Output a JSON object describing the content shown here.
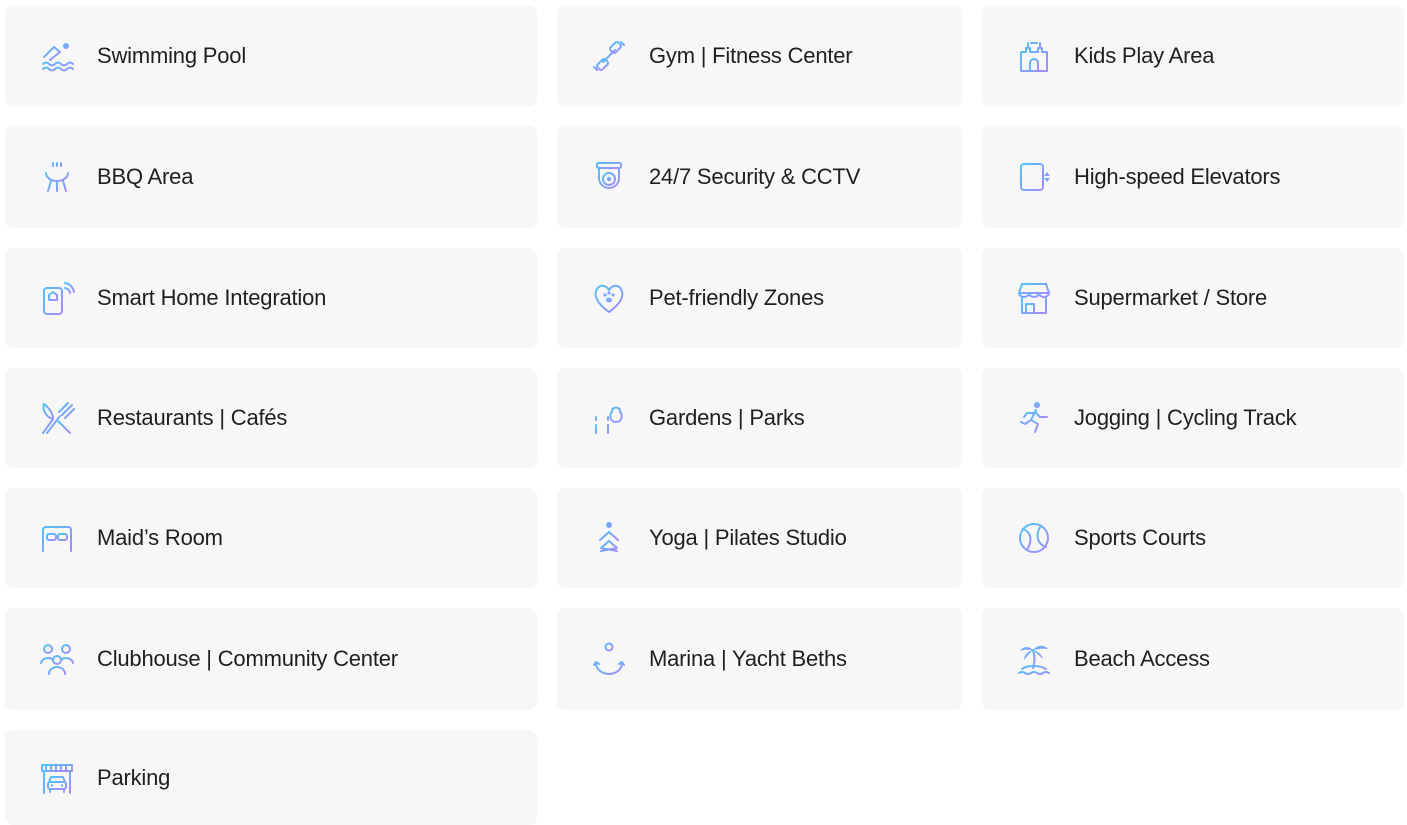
{
  "colors": {
    "card_background": "#f7f7f7",
    "icon_gradient_start": "#4fc3f7",
    "icon_gradient_end": "#a78bfa",
    "text": "#1f1f1f"
  },
  "amenities": [
    {
      "label": "Swimming Pool",
      "icon": "swimming-pool-icon"
    },
    {
      "label": "Gym | Fitness Center",
      "icon": "dumbbell-icon"
    },
    {
      "label": "Kids Play Area",
      "icon": "castle-icon"
    },
    {
      "label": "BBQ Area",
      "icon": "bbq-grill-icon"
    },
    {
      "label": "24/7 Security & CCTV",
      "icon": "cctv-camera-icon"
    },
    {
      "label": "High-speed Elevators",
      "icon": "elevator-icon"
    },
    {
      "label": "Smart Home Integration",
      "icon": "smart-phone-home-icon"
    },
    {
      "label": "Pet-friendly Zones",
      "icon": "heart-paw-icon"
    },
    {
      "label": "Supermarket / Store",
      "icon": "storefront-icon"
    },
    {
      "label": "Restaurants | Cafés",
      "icon": "fork-knife-icon"
    },
    {
      "label": "Gardens | Parks",
      "icon": "park-bench-tree-icon"
    },
    {
      "label": "Jogging | Cycling Track",
      "icon": "running-person-icon"
    },
    {
      "label": "Maid’s Room",
      "icon": "bed-icon"
    },
    {
      "label": "Yoga | Pilates Studio",
      "icon": "yoga-pose-icon"
    },
    {
      "label": "Sports Courts",
      "icon": "tennis-ball-icon"
    },
    {
      "label": "Clubhouse | Community Center",
      "icon": "community-people-icon"
    },
    {
      "label": "Marina | Yacht Beths",
      "icon": "anchor-icon"
    },
    {
      "label": "Beach Access",
      "icon": "palm-island-icon"
    },
    {
      "label": "Parking",
      "icon": "car-garage-icon"
    }
  ]
}
